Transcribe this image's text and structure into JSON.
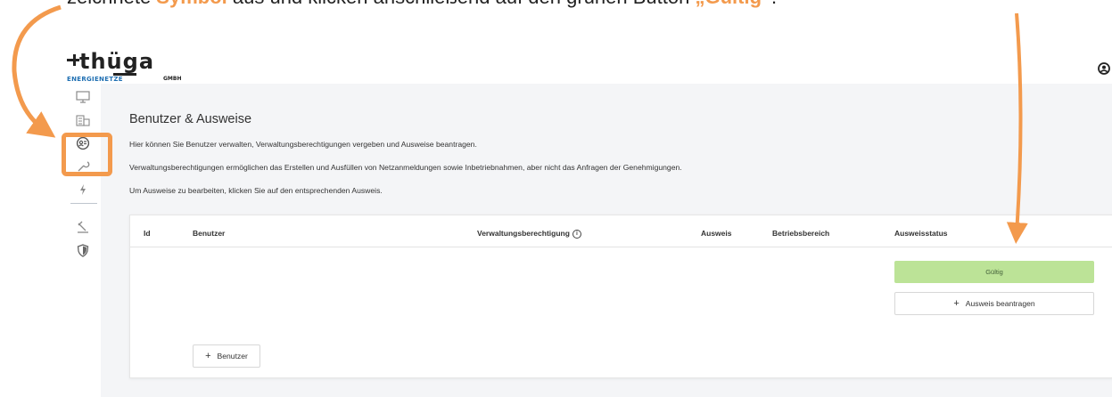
{
  "caption": {
    "text_before": "zeichnete ",
    "highlight1": "Symbol",
    "text_middle": " aus und klicken anschließend auf den grünen Button ",
    "highlight2": "„Gültig“",
    "text_after": "."
  },
  "logo": {
    "wordmark": "thüga",
    "line1": "ENERGIENETZE",
    "line2": "GMBH"
  },
  "header": {
    "user_icon": "user-circle-icon"
  },
  "sidebar": {
    "items": [
      {
        "icon": "monitor-icon"
      },
      {
        "icon": "building-icon"
      },
      {
        "icon": "badge-user-icon",
        "active": true
      },
      {
        "icon": "wrench-icon"
      },
      {
        "icon": "lightning-icon"
      },
      {
        "icon": "hammer-icon"
      },
      {
        "icon": "shield-icon"
      }
    ]
  },
  "page": {
    "title": "Benutzer & Ausweise",
    "paragraphs": [
      "Hier können Sie Benutzer verwalten, Verwaltungsberechtigungen vergeben und Ausweise beantragen.",
      "Verwaltungsberechtigungen ermöglichen das Erstellen und Ausfüllen von Netzanmeldungen sowie Inbetriebnahmen, aber nicht das Anfragen der Genehmigungen.",
      "Um Ausweise zu bearbeiten, klicken Sie auf den entsprechenden Ausweis."
    ]
  },
  "table": {
    "columns": [
      "Id",
      "Benutzer",
      "Verwaltungsberechtigung",
      "Ausweis",
      "Betriebsbereich",
      "Ausweisstatus"
    ],
    "status_badge": "Gültig",
    "request_button": "Ausweis beantragen",
    "add_user_button": "Benutzer"
  },
  "colors": {
    "annotation": "#f39a4d",
    "status_green": "#bce397",
    "content_bg": "#f4f5f7"
  }
}
